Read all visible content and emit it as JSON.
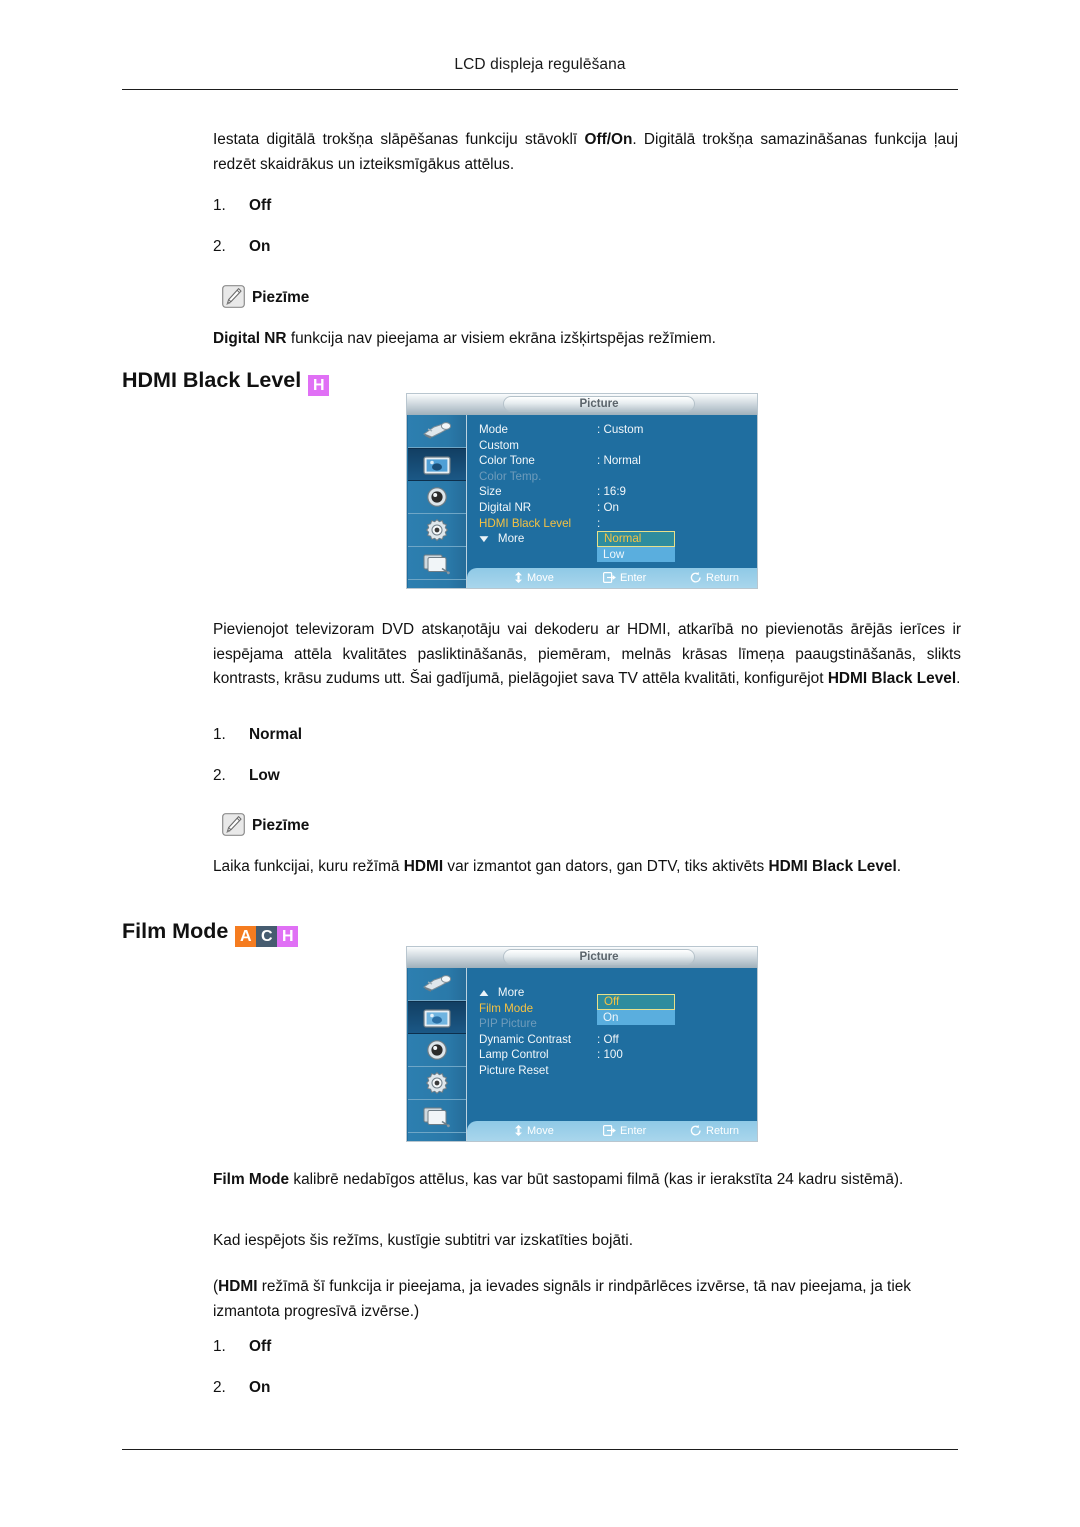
{
  "header": {
    "running_title": "LCD displeja regulēšana"
  },
  "intro": {
    "paragraph_lead": "Iestata digitālā trokšņa slāpēšanas funkciju stāvoklī ",
    "paragraph_bold": "Off/On",
    "paragraph_tail": ". Digitālā trokšņa samazināšanas funkcija ļauj redzēt skaidrākus un izteiksmīgākus attēlus.",
    "options": [
      {
        "num": "1.",
        "label": "Off"
      },
      {
        "num": "2.",
        "label": "On"
      }
    ],
    "note_label": "Piezīme",
    "note_bold": "Digital NR",
    "note_tail": " funkcija nav pieejama ar visiem ekrāna izšķirtspējas režīmiem."
  },
  "section_hdmi_black_level": {
    "title": "HDMI Black Level",
    "badges": [
      {
        "letter": "H",
        "color": "#e070f5"
      }
    ],
    "paragraph_lead": "Pievienojot televizoram DVD atskaņotāju vai dekoderu ar HDMI, atkarībā no pievienotās ārējās ierīces ir iespējama attēla kvalitātes pasliktināšanās, piemēram, melnās krāsas līmeņa paaugstināšanās, slikts kontrasts, krāsu zudums utt. Šai gadījumā, pielāgojiet sava TV attēla kvalitāti, konfigurējot ",
    "paragraph_bold": "HDMI Black Level",
    "paragraph_tail": ".",
    "options": [
      {
        "num": "1.",
        "label": "Normal"
      },
      {
        "num": "2.",
        "label": "Low"
      }
    ],
    "note_label": "Piezīme",
    "note_lead": "Laika funkcijai, kuru režīmā ",
    "note_bold1": "HDMI",
    "note_mid": " var izmantot gan dators, gan DTV, tiks aktivēts ",
    "note_bold2": "HDMI Black Level",
    "note_tail": "."
  },
  "section_film_mode": {
    "title": "Film Mode",
    "badges": [
      {
        "letter": "A",
        "color": "#f57c20"
      },
      {
        "letter": "C",
        "color": "#465c70"
      },
      {
        "letter": "H",
        "color": "#e070f5"
      }
    ],
    "paragraph1_bold": "Film Mode",
    "paragraph1_tail": " kalibrē nedabīgos attēlus, kas var būt sastopami filmā (kas ir ierakstīta 24 kadru sistēmā).",
    "paragraph2": "Kad iespējots šis režīms, kustīgie subtitri var izskatīties bojāti.",
    "paragraph3_lead": "(",
    "paragraph3_bold": "HDMI",
    "paragraph3_tail": " režīmā šī funkcija ir pieejama, ja ievades signāls ir rindpārlēces izvērse, tā nav pieejama, ja tiek izmantota progresīvā izvērse.)",
    "options": [
      {
        "num": "1.",
        "label": "Off"
      },
      {
        "num": "2.",
        "label": "On"
      }
    ]
  },
  "osd_picture_hdmi": {
    "window_title": "Picture",
    "rail_icons": [
      "input-source-icon",
      "picture-icon",
      "sound-speaker-icon",
      "setup-gear-icon",
      "multi-display-icon"
    ],
    "selected_rail_index": 1,
    "rows": [
      {
        "label": "Mode",
        "value": ": Custom",
        "state": "normal"
      },
      {
        "label": "Custom",
        "value": "",
        "state": "normal"
      },
      {
        "label": "Color Tone",
        "value": ": Normal",
        "state": "normal"
      },
      {
        "label": "Color Temp.",
        "value": "",
        "state": "disabled"
      },
      {
        "label": "Size",
        "value": ": 16:9",
        "state": "normal"
      },
      {
        "label": "Digital NR",
        "value": ": On",
        "state": "normal"
      },
      {
        "label": "HDMI Black Level",
        "value": ":",
        "state": "highlighted"
      },
      {
        "label": "More",
        "value": "",
        "state": "normal",
        "arrow": "▼"
      }
    ],
    "dropdown": {
      "options": [
        "Normal",
        "Low"
      ],
      "selected": "Normal"
    },
    "hints": [
      {
        "icon": "updown-arrows-icon",
        "label": "Move"
      },
      {
        "icon": "enter-icon",
        "label": "Enter"
      },
      {
        "icon": "return-icon",
        "label": "Return"
      }
    ]
  },
  "osd_picture_film": {
    "window_title": "Picture",
    "rail_icons": [
      "input-source-icon",
      "picture-icon",
      "sound-speaker-icon",
      "setup-gear-icon",
      "multi-display-icon"
    ],
    "selected_rail_index": 1,
    "rows": [
      {
        "label": "More",
        "value": "",
        "state": "normal",
        "arrow": "▲"
      },
      {
        "label": "Film Mode",
        "value": ":",
        "state": "highlighted"
      },
      {
        "label": "PIP Picture",
        "value": "",
        "state": "disabled"
      },
      {
        "label": "Dynamic Contrast",
        "value": ": Off",
        "state": "normal"
      },
      {
        "label": "Lamp Control",
        "value": ": 100",
        "state": "normal"
      },
      {
        "label": "Picture Reset",
        "value": "",
        "state": "normal"
      }
    ],
    "dropdown": {
      "options": [
        "Off",
        "On"
      ],
      "selected": "Off"
    },
    "hints": [
      {
        "icon": "updown-arrows-icon",
        "label": "Move"
      },
      {
        "icon": "enter-icon",
        "label": "Enter"
      },
      {
        "icon": "return-icon",
        "label": "Return"
      }
    ]
  }
}
